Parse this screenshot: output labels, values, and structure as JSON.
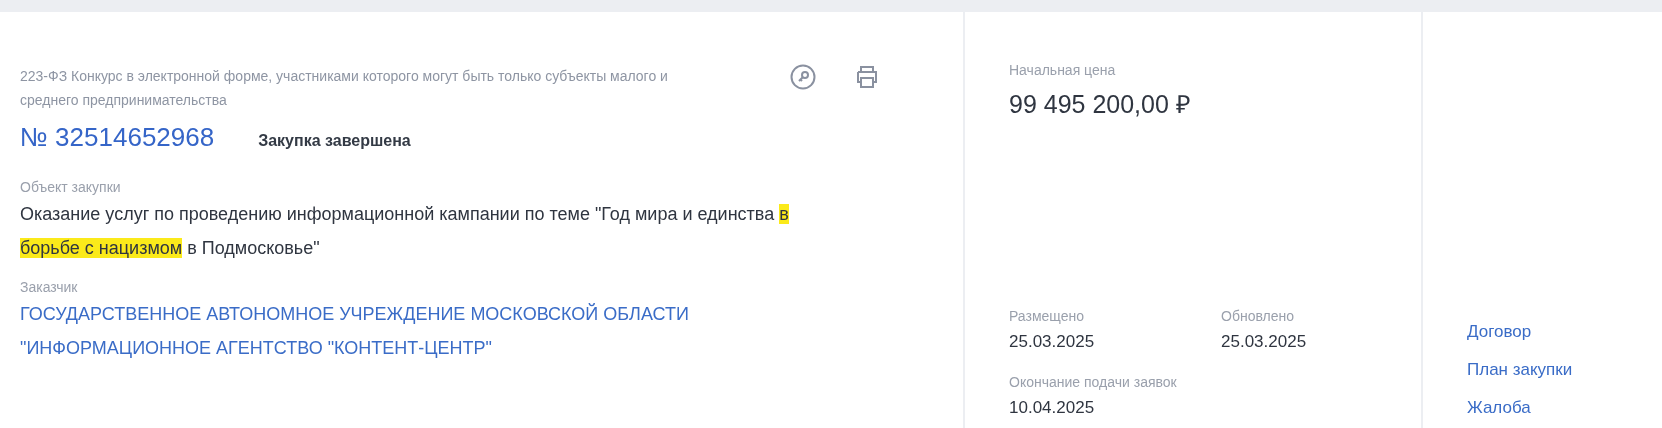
{
  "purchase": {
    "type_text": "223-ФЗ Конкурс в электронной форме, участниками которого могут быть только субъекты малого и среднего предпринимательства",
    "number": "№ 32514652968",
    "status": "Закупка завершена",
    "object_label": "Объект закупки",
    "object_segments": [
      {
        "text": "Оказание услуг по проведению информационной кампании по теме \"Год мира и единства ",
        "highlighted": false
      },
      {
        "text": "в борьбе с нацизмом",
        "highlighted": true
      },
      {
        "text": " в Подмосковье\"",
        "highlighted": false
      }
    ],
    "customer_label": "Заказчик",
    "customer": "ГОСУДАРСТВЕННОЕ АВТОНОМНОЕ УЧРЕЖДЕНИЕ МОСКОВСКОЙ ОБЛАСТИ \"ИНФОРМАЦИОННОЕ АГЕНТСТВО \"КОНТЕНТ-ЦЕНТР\""
  },
  "price": {
    "label": "Начальная цена",
    "value": "99 495 200,00 ₽"
  },
  "dates": [
    {
      "label": "Размещено",
      "value": "25.03.2025"
    },
    {
      "label": "Обновлено",
      "value": "25.03.2025"
    },
    {
      "label": "Окончание подачи заявок",
      "value": "10.04.2025"
    }
  ],
  "links": [
    "Договор",
    "План закупки",
    "Жалоба"
  ]
}
